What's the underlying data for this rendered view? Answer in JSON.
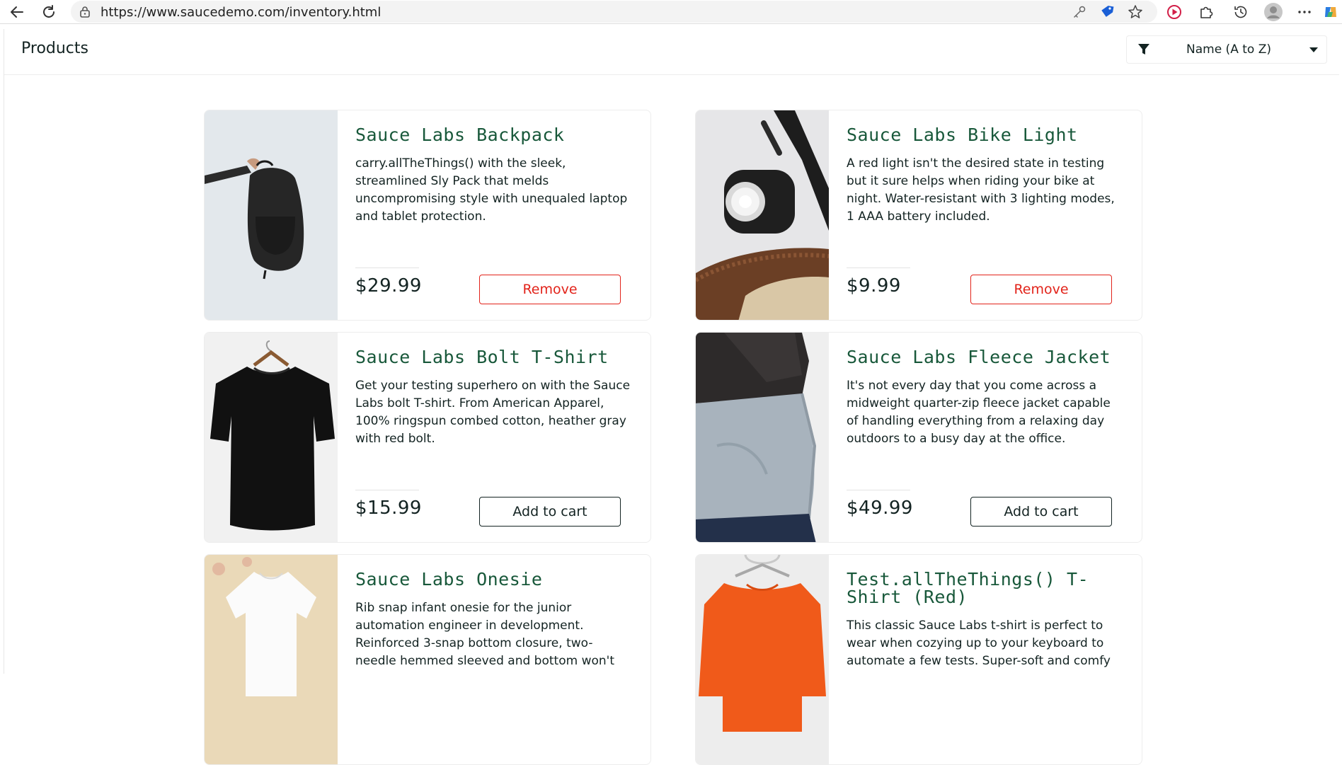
{
  "browser": {
    "url": "https://www.saucedemo.com/inventory.html"
  },
  "header": {
    "title": "Products",
    "sort_selected": "Name (A to Z)"
  },
  "colors": {
    "product_name": "#18583a",
    "remove_button": "#e2231a",
    "text": "#132322"
  },
  "products": [
    {
      "name": "Sauce Labs Backpack",
      "description": "carry.allTheThings() with the sleek, streamlined Sly Pack that melds uncompromising style with unequaled laptop and tablet protection.",
      "price": "$29.99",
      "button": "Remove"
    },
    {
      "name": "Sauce Labs Bike Light",
      "description": "A red light isn't the desired state in testing but it sure helps when riding your bike at night. Water-resistant with 3 lighting modes, 1 AAA battery included.",
      "price": "$9.99",
      "button": "Remove"
    },
    {
      "name": "Sauce Labs Bolt T-Shirt",
      "description": "Get your testing superhero on with the Sauce Labs bolt T-shirt. From American Apparel, 100% ringspun combed cotton, heather gray with red bolt.",
      "price": "$15.99",
      "button": "Add to cart"
    },
    {
      "name": "Sauce Labs Fleece Jacket",
      "description": "It's not every day that you come across a midweight quarter-zip fleece jacket capable of handling everything from a relaxing day outdoors to a busy day at the office.",
      "price": "$49.99",
      "button": "Add to cart"
    },
    {
      "name": "Sauce Labs Onesie",
      "description": "Rib snap infant onesie for the junior automation engineer in development. Reinforced 3-snap bottom closure, two-needle hemmed sleeved and bottom won't",
      "price": "",
      "button": ""
    },
    {
      "name": "Test.allTheThings() T-Shirt (Red)",
      "description": "This classic Sauce Labs t-shirt is perfect to wear when cozying up to your keyboard to automate a few tests. Super-soft and comfy",
      "price": "",
      "button": ""
    }
  ]
}
